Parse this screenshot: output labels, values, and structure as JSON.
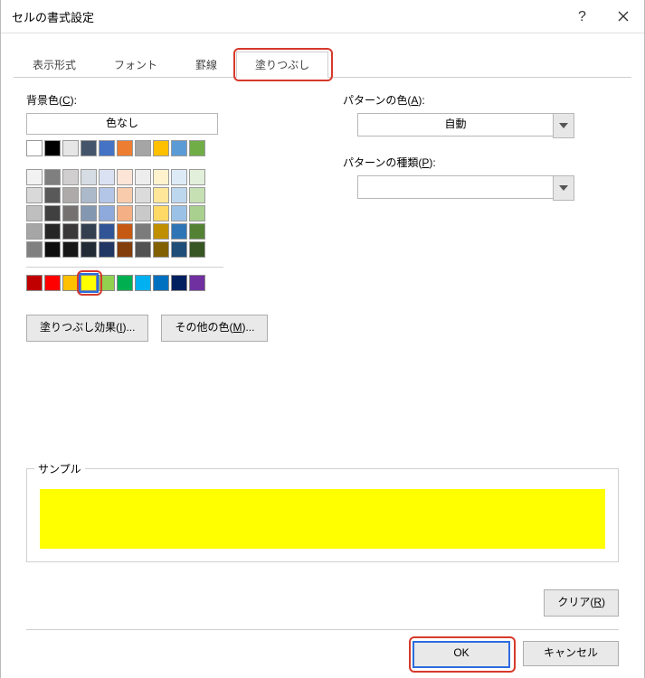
{
  "title": "セルの書式設定",
  "tabs": [
    "表示形式",
    "フォント",
    "罫線",
    "塗りつぶし"
  ],
  "active_tab_index": 3,
  "labels": {
    "background": "背景色(",
    "background_key": "C",
    "background_suffix": "):",
    "nocolor": "色なし",
    "pattern_color": "パターンの色(",
    "pattern_color_key": "A",
    "pattern_color_suffix": "):",
    "pattern_color_value": "自動",
    "pattern_type": "パターンの種類(",
    "pattern_type_key": "P",
    "pattern_type_suffix": "):",
    "effects": "塗りつぶし効果(",
    "effects_key": "I",
    "effects_suffix": ")...",
    "more_colors": "その他の色(",
    "more_colors_key": "M",
    "more_colors_suffix": ")...",
    "sample": "サンプル",
    "clear": "クリア(",
    "clear_key": "R",
    "clear_suffix": ")",
    "ok": "OK",
    "cancel": "キャンセル"
  },
  "basic_colors_row": [
    "#FFFFFF",
    "#000000",
    "#E7E6E6",
    "#44546A",
    "#4472C4",
    "#ED7D31",
    "#A5A5A5",
    "#FFC000",
    "#5B9BD5",
    "#70AD47"
  ],
  "theme_grid": [
    [
      "#F2F2F2",
      "#7F7F7F",
      "#D0CECE",
      "#D6DCE4",
      "#D9E1F2",
      "#FCE4D6",
      "#EDEDED",
      "#FFF2CC",
      "#DDEBF7",
      "#E2EFDA"
    ],
    [
      "#D9D9D9",
      "#595959",
      "#AEAAAA",
      "#ACB9CA",
      "#B4C6E7",
      "#F8CBAD",
      "#DBDBDB",
      "#FFE699",
      "#BDD7EE",
      "#C6E0B4"
    ],
    [
      "#BFBFBF",
      "#404040",
      "#757171",
      "#8497B0",
      "#8EA9DB",
      "#F4B084",
      "#C9C9C9",
      "#FFD966",
      "#9BC2E6",
      "#A9D08E"
    ],
    [
      "#A6A6A6",
      "#262626",
      "#3A3838",
      "#333F4F",
      "#305496",
      "#C65911",
      "#7B7B7B",
      "#BF8F00",
      "#2F75B5",
      "#548235"
    ],
    [
      "#808080",
      "#0D0D0D",
      "#161616",
      "#222B35",
      "#203764",
      "#833C0C",
      "#525252",
      "#806000",
      "#1F4E78",
      "#375623"
    ]
  ],
  "standard_colors": [
    "#C00000",
    "#FF0000",
    "#FFC000",
    "#FFFF00",
    "#92D050",
    "#00B050",
    "#00B0F0",
    "#0070C0",
    "#002060",
    "#7030A0"
  ],
  "selected_standard_index": 3,
  "sample_color": "#FFFF00"
}
